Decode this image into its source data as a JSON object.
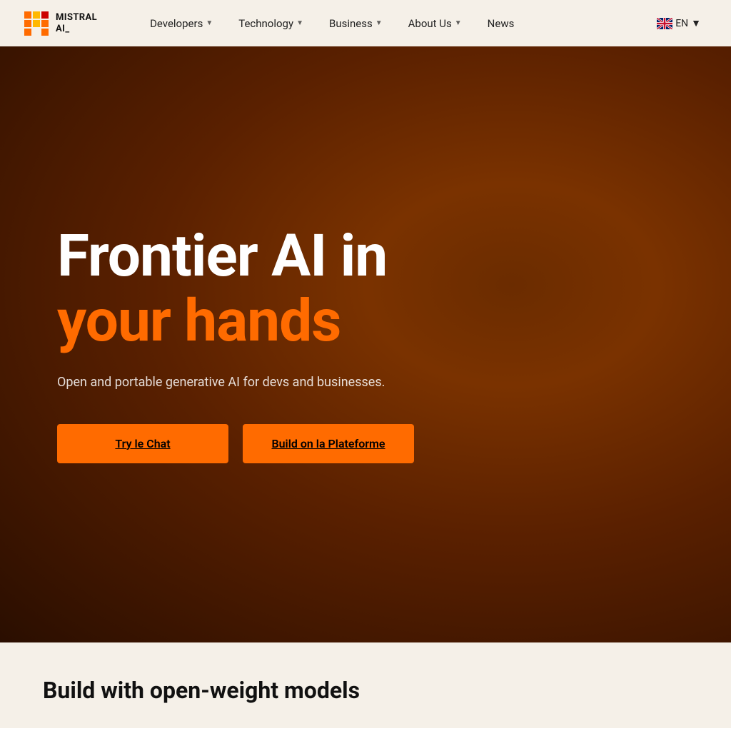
{
  "brand": {
    "logo_line1": "MISTRAL",
    "logo_line2": "AI_"
  },
  "nav": {
    "links": [
      {
        "label": "Developers",
        "has_dropdown": true
      },
      {
        "label": "Technology",
        "has_dropdown": true
      },
      {
        "label": "Business",
        "has_dropdown": true
      },
      {
        "label": "About Us",
        "has_dropdown": true
      },
      {
        "label": "News",
        "has_dropdown": false
      }
    ],
    "lang_label": "EN"
  },
  "hero": {
    "headline_white": "Frontier AI in",
    "headline_orange": "your hands",
    "subtitle": "Open and portable generative AI for devs and businesses.",
    "btn_primary": "Try le Chat",
    "btn_secondary": "Build on la Plateforme"
  },
  "below_section": {
    "title": "Build with open-weight models"
  }
}
